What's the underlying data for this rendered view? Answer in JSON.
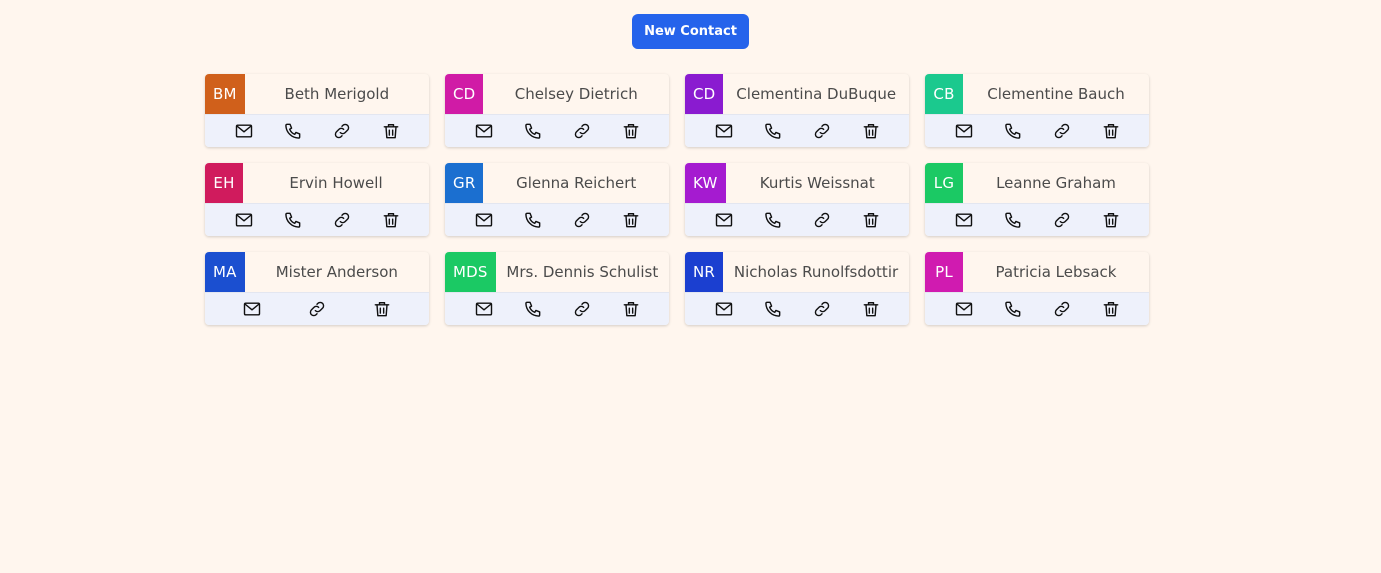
{
  "header": {
    "new_contact_label": "New Contact"
  },
  "contacts": [
    {
      "initials": "BM",
      "name": "Beth Merigold",
      "color": "#d0601b",
      "actions": [
        "mail",
        "phone",
        "link",
        "trash"
      ]
    },
    {
      "initials": "CD",
      "name": "Chelsey Dietrich",
      "color": "#d01ba6",
      "actions": [
        "mail",
        "phone",
        "link",
        "trash"
      ]
    },
    {
      "initials": "CD",
      "name": "Clementina DuBuque",
      "color": "#8a1bd0",
      "actions": [
        "mail",
        "phone",
        "link",
        "trash"
      ]
    },
    {
      "initials": "CB",
      "name": "Clementine Bauch",
      "color": "#1bc98e",
      "actions": [
        "mail",
        "phone",
        "link",
        "trash"
      ]
    },
    {
      "initials": "EH",
      "name": "Ervin Howell",
      "color": "#d01b5d",
      "actions": [
        "mail",
        "phone",
        "link",
        "trash"
      ]
    },
    {
      "initials": "GR",
      "name": "Glenna Reichert",
      "color": "#1b6fd0",
      "actions": [
        "mail",
        "phone",
        "link",
        "trash"
      ]
    },
    {
      "initials": "KW",
      "name": "Kurtis Weissnat",
      "color": "#a51bd0",
      "actions": [
        "mail",
        "phone",
        "link",
        "trash"
      ]
    },
    {
      "initials": "LG",
      "name": "Leanne Graham",
      "color": "#1bc964",
      "actions": [
        "mail",
        "phone",
        "link",
        "trash"
      ]
    },
    {
      "initials": "MA",
      "name": "Mister Anderson",
      "color": "#1b4fd0",
      "actions": [
        "mail",
        "link",
        "trash"
      ]
    },
    {
      "initials": "MDS",
      "name": "Mrs. Dennis Schulist",
      "color": "#1bc964",
      "actions": [
        "mail",
        "phone",
        "link",
        "trash"
      ]
    },
    {
      "initials": "NR",
      "name": "Nicholas Runolfsdottir",
      "color": "#1b3fd0",
      "actions": [
        "mail",
        "phone",
        "link",
        "trash"
      ]
    },
    {
      "initials": "PL",
      "name": "Patricia Lebsack",
      "color": "#d01bb0",
      "actions": [
        "mail",
        "phone",
        "link",
        "trash"
      ]
    }
  ]
}
